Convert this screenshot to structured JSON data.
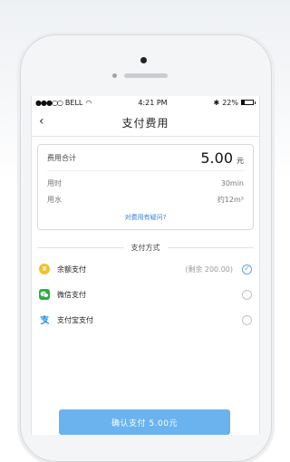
{
  "status_bar": {
    "carrier": "BELL",
    "time": "4:21 PM",
    "battery": "22%"
  },
  "nav": {
    "back_glyph": "‹",
    "title": "支付费用"
  },
  "summary": {
    "total_label": "费用合计",
    "total_amount": "5.00",
    "total_unit": "元",
    "duration_label": "用时",
    "duration_value": "30min",
    "water_label": "用水",
    "water_value": "约12m³",
    "question_link": "对费用有疑问?"
  },
  "payment": {
    "section_title": "支付方式",
    "methods": [
      {
        "label": "余额支付",
        "note": "(剩余 200.00)",
        "icon": "yuan-coin-icon",
        "selected": true
      },
      {
        "label": "微信支付",
        "note": "",
        "icon": "wechat-icon",
        "selected": false
      },
      {
        "label": "支付宝支付",
        "note": "",
        "icon": "alipay-icon",
        "selected": false
      }
    ]
  },
  "confirm_button": {
    "label": "确认支付 5.00元"
  },
  "colors": {
    "accent": "#6ab3ef",
    "link": "#3b7fe0",
    "balance_icon": "#f2c12e",
    "wechat_icon": "#2aae3e",
    "alipay_icon": "#1b8ee6"
  }
}
